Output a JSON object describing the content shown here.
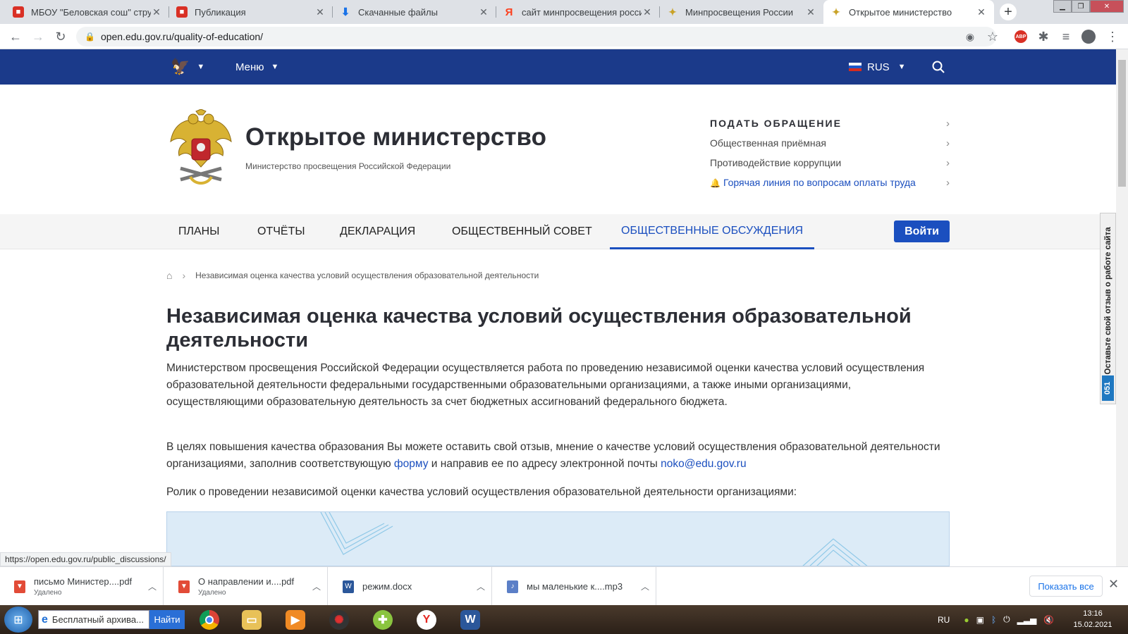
{
  "browser": {
    "tabs": [
      {
        "title": "МБОУ \"Беловская сош\" структ",
        "favicon_color": "#d93025",
        "active": false
      },
      {
        "title": "Публикация",
        "favicon_color": "#d93025",
        "active": false
      },
      {
        "title": "Скачанные файлы",
        "favicon_color": "#1a73e8",
        "active": false
      },
      {
        "title": "сайт минпросвещения росси",
        "favicon_color": "#fc3f1d",
        "active": false
      },
      {
        "title": "Минпросвещения России",
        "favicon_color": "#c9a227",
        "active": false
      },
      {
        "title": "Открытое министерство",
        "favicon_color": "#c9a227",
        "active": true
      }
    ],
    "url": "open.edu.gov.ru/quality-of-education/",
    "status_url": "https://open.edu.gov.ru/public_discussions/"
  },
  "site": {
    "menu_label": "Меню",
    "lang": "RUS",
    "title": "Открытое министерство",
    "subtitle": "Министерство просвещения Российской Федерации",
    "header_links": [
      {
        "label": "ПОДАТЬ ОБРАЩЕНИЕ"
      },
      {
        "label": "Общественная приёмная"
      },
      {
        "label": "Противодействие коррупции"
      },
      {
        "label": "Горячая линия по вопросам оплаты труда"
      }
    ],
    "section_nav": [
      {
        "label": "ПЛАНЫ"
      },
      {
        "label": "ОТЧЁТЫ"
      },
      {
        "label": "ДЕКЛАРАЦИЯ"
      },
      {
        "label": "ОБЩЕСТВЕННЫЙ СОВЕТ"
      },
      {
        "label": "ОБЩЕСТВЕННЫЕ ОБСУЖДЕНИЯ",
        "active": true
      }
    ],
    "login_label": "Войти",
    "accent": "#1b3a8a",
    "link_color": "#1b4fbf"
  },
  "main": {
    "breadcrumb": "Независимая оценка качества условий осуществления образовательной деятельности",
    "heading": "Независимая оценка качества условий осуществления образовательной деятельности",
    "para1": "Министерством просвещения Российской Федерации осуществляется работа по проведению независимой оценки качества условий осуществления образовательной деятельности федеральными государственными образовательными организациями, а также иными организациями, осуществляющими образовательную деятельность за счет бюджетных ассигнований федерального бюджета.",
    "para2_start": "В целях повышения качества образования Вы можете оставить свой отзыв, мнение о качестве условий осуществления образовательной деятельности организациями, заполнив соответствующую ",
    "para2_link1": "форму",
    "para2_mid": " и направив ее по адресу электронной почты ",
    "para2_link2": "noko@edu.gov.ru",
    "para3": "Ролик о проведении независимой оценки качества условий осуществления образовательной деятельности организациями:"
  },
  "feedback": {
    "text": "Оставьте свой отзыв о работе сайта",
    "badge": "051"
  },
  "downloads": {
    "items": [
      {
        "name": "письмо Министер....pdf",
        "sub": "Удалено",
        "icon": "pdf"
      },
      {
        "name": "О направлении и....pdf",
        "sub": "Удалено",
        "icon": "pdf"
      },
      {
        "name": "режим.docx",
        "sub": "",
        "icon": "docx"
      },
      {
        "name": "мы маленькие к....mp3",
        "sub": "",
        "icon": "mp3"
      }
    ],
    "show_all": "Показать все"
  },
  "taskbar": {
    "search_text": "Бесплатный архива...",
    "search_button": "Найти",
    "lang": "RU",
    "time": "13:16",
    "date": "15.02.2021"
  }
}
